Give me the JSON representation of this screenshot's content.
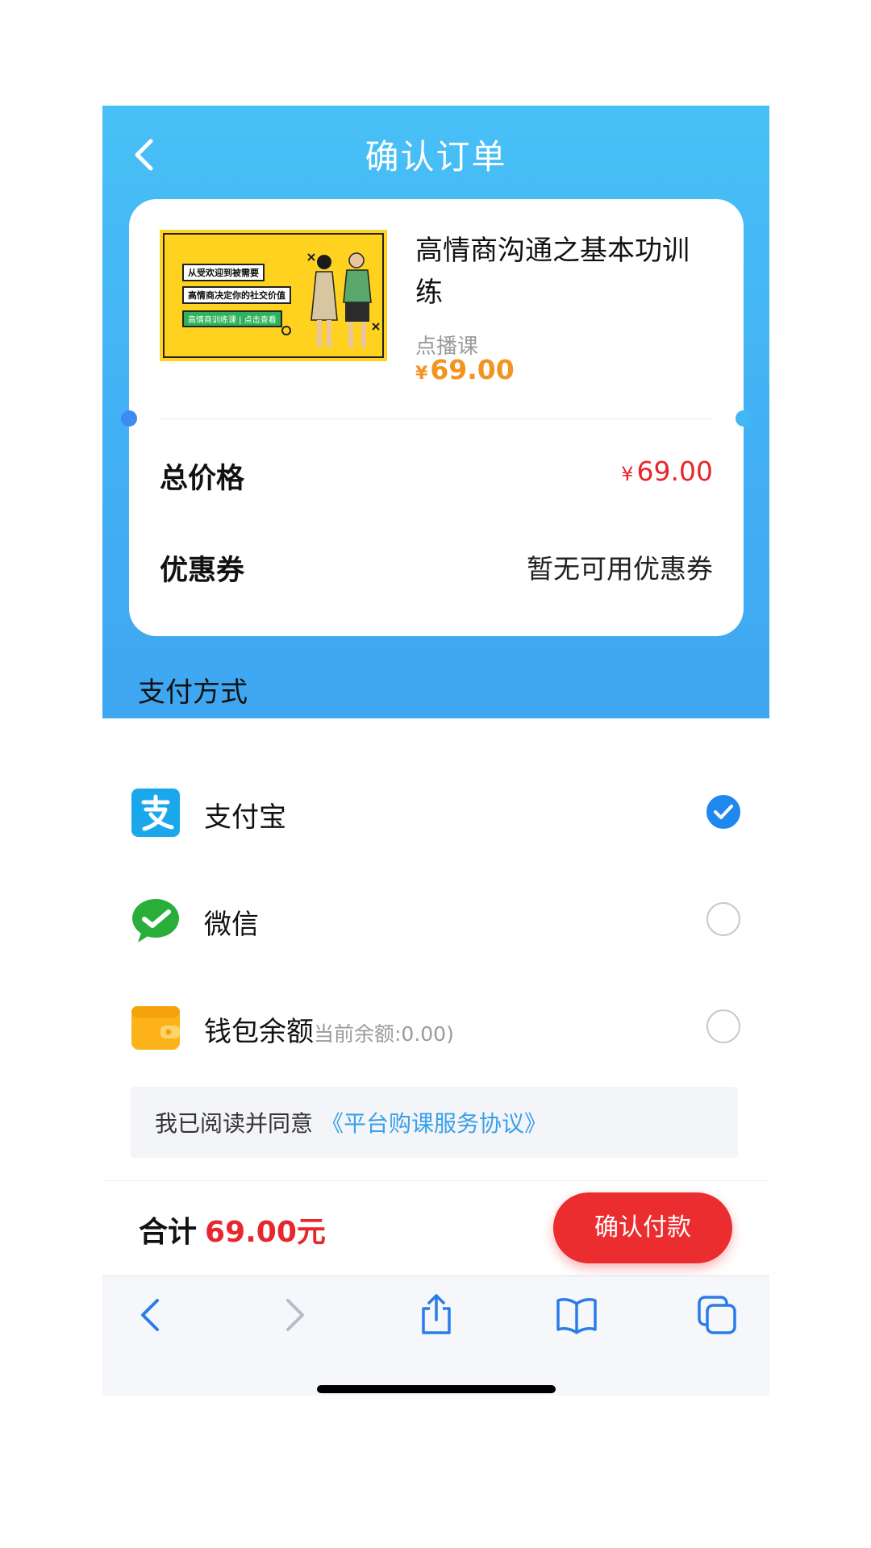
{
  "header": {
    "title": "确认订单"
  },
  "course": {
    "name": "高情商沟通之基本功训练",
    "type": "点播课",
    "price_symbol": "¥",
    "price": "69.00",
    "thumbnail": {
      "line1": "从受欢迎到被需要",
      "line2": "高情商决定你的社交价值",
      "line3": "高情商训练课 | 点击查看"
    }
  },
  "summary": {
    "total_label": "总价格",
    "total_symbol": "¥",
    "total_value": "69.00",
    "coupon_label": "优惠券",
    "coupon_value": "暂无可用优惠券"
  },
  "payment": {
    "heading": "支付方式",
    "methods": [
      {
        "label": "支付宝",
        "icon": "alipay-icon",
        "selected": true
      },
      {
        "label": "微信",
        "icon": "wechat-icon",
        "selected": false
      },
      {
        "label": "钱包余额",
        "sub": "当前余额:0.00)",
        "icon": "wallet-icon",
        "selected": false
      }
    ]
  },
  "agreement": {
    "text": "我已阅读并同意",
    "link": "《平台购课服务协议》"
  },
  "footer": {
    "total_label": "合计",
    "total_amount": "69.00元",
    "pay_button": "确认付款"
  },
  "colors": {
    "accent_blue": "#42b0f4",
    "price_orange": "#f39320",
    "price_red": "#e8262d",
    "selected_blue": "#1f88ee",
    "pay_button": "#ec2d30"
  },
  "browser_toolbar": {
    "icons": [
      "back-icon",
      "forward-icon",
      "share-icon",
      "bookmarks-icon",
      "tabs-icon"
    ]
  }
}
